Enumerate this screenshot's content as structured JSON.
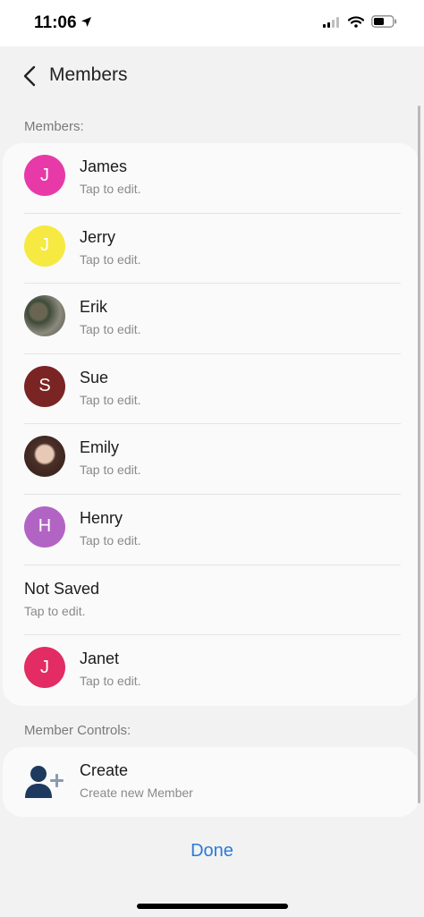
{
  "status": {
    "time": "11:06"
  },
  "header": {
    "title": "Members"
  },
  "members_section": {
    "label": "Members:"
  },
  "members": [
    {
      "name": "James",
      "sub": "Tap to edit.",
      "initial": "J",
      "color": "#e73aa8"
    },
    {
      "name": "Jerry",
      "sub": "Tap to edit.",
      "initial": "J",
      "color": "#f6e941"
    },
    {
      "name": "Erik",
      "sub": "Tap to edit.",
      "initial": "",
      "color": "photo"
    },
    {
      "name": "Sue",
      "sub": "Tap to edit.",
      "initial": "S",
      "color": "#7a2524"
    },
    {
      "name": "Emily",
      "sub": "Tap to edit.",
      "initial": "",
      "color": "photo"
    },
    {
      "name": "Henry",
      "sub": "Tap to edit.",
      "initial": "H",
      "color": "#b264c4"
    },
    {
      "name": "Not Saved",
      "sub": "Tap to edit.",
      "initial": "",
      "color": "none"
    },
    {
      "name": "Janet",
      "sub": "Tap to edit.",
      "initial": "J",
      "color": "#e22c63"
    }
  ],
  "controls_section": {
    "label": "Member Controls:"
  },
  "create": {
    "title": "Create",
    "sub": "Create new Member"
  },
  "done": {
    "label": "Done"
  }
}
